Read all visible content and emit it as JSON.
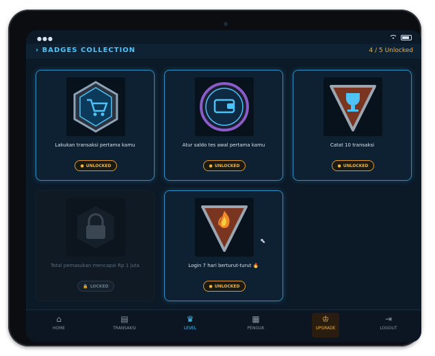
{
  "header": {
    "title": "BADGES COLLECTION",
    "count": "4 / 5 Unlocked"
  },
  "cards": [
    {
      "description": "Lakukan transaksi pertama kamu",
      "status": "UNLOCKED",
      "icon": "cart-hexagon-icon"
    },
    {
      "description": "Atur saldo tes awal pertama kamu",
      "status": "UNLOCKED",
      "icon": "wallet-circle-icon"
    },
    {
      "description": "Catat 10 transaksi",
      "status": "UNLOCKED",
      "icon": "trophy-triangle-icon"
    },
    {
      "description": "Total pemasukan mencapai Rp 1 juta",
      "status": "LOCKED",
      "icon": "lock-icon"
    },
    {
      "description": "Login 7 hari berturut-turut 🔥",
      "status": "UNLOCKED",
      "icon": "fire-triangle-icon"
    }
  ],
  "nav": [
    {
      "label": "HOME",
      "icon": "home-icon"
    },
    {
      "label": "TRANSAKSI",
      "icon": "transaction-icon"
    },
    {
      "label": "LEVEL",
      "icon": "trophy-icon"
    },
    {
      "label": "PENGUK",
      "icon": "calendar-icon"
    },
    {
      "label": "UPGRADE",
      "icon": "crown-icon"
    },
    {
      "label": "LOGOUT",
      "icon": "logout-icon"
    }
  ],
  "colors": {
    "accent": "#4fc3f7",
    "gold": "#f2b53c",
    "background": "#0c1a28"
  }
}
